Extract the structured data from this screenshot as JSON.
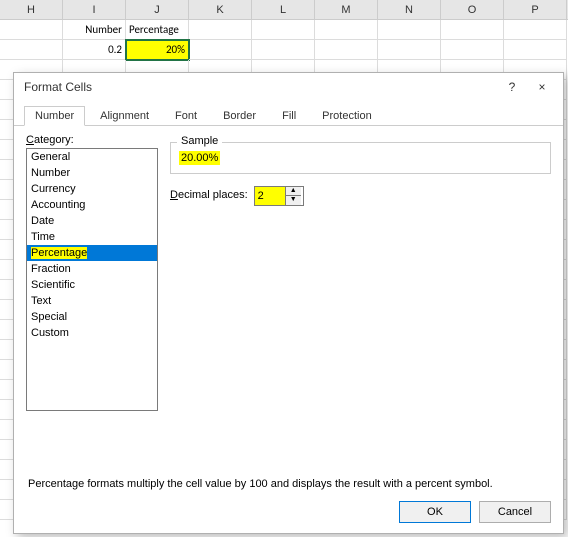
{
  "sheet": {
    "columns": [
      "H",
      "I",
      "J",
      "K",
      "L",
      "M",
      "N",
      "O",
      "P"
    ],
    "row1": {
      "i": "Number",
      "j": "Percentage"
    },
    "row2": {
      "i": "0.2",
      "j": "20%"
    }
  },
  "dialog": {
    "title": "Format Cells",
    "help_symbol": "?",
    "close_symbol": "×",
    "tabs": [
      "Number",
      "Alignment",
      "Font",
      "Border",
      "Fill",
      "Protection"
    ],
    "active_tab": 0,
    "category_label": "Category:",
    "categories": [
      "General",
      "Number",
      "Currency",
      "Accounting",
      "Date",
      "Time",
      "Percentage",
      "Fraction",
      "Scientific",
      "Text",
      "Special",
      "Custom"
    ],
    "selected_category": "Percentage",
    "sample_label": "Sample",
    "sample_value": "20.00%",
    "decimal_label": "Decimal places:",
    "decimal_value": "2",
    "description": "Percentage formats multiply the cell value by 100 and displays the result with a percent symbol.",
    "ok": "OK",
    "cancel": "Cancel"
  }
}
